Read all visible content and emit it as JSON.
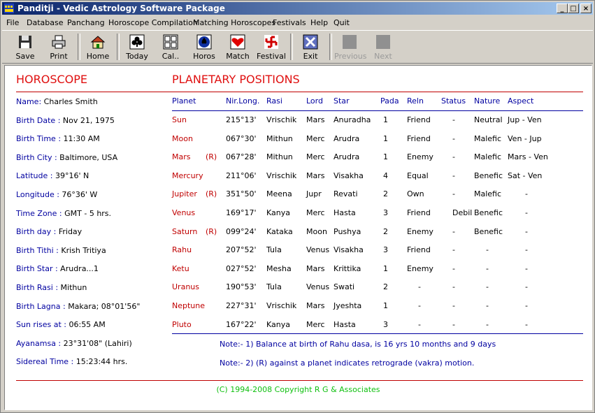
{
  "window": {
    "title": "Panditji - Vedic Astrology Software Package"
  },
  "menu": [
    "File",
    "Database",
    "Panchang",
    "Horoscope Compilation",
    "Matching Horoscopes",
    "Festivals",
    "Help",
    "Quit"
  ],
  "toolbar": {
    "save": "Save",
    "print": "Print",
    "home": "Home",
    "today": "Today",
    "cal": "Cal..",
    "horos": "Horos",
    "match": "Match",
    "festival": "Festival",
    "exit": "Exit",
    "previous": "Previous",
    "next": "Next"
  },
  "horoscope": {
    "heading": "HOROSCOPE",
    "fields": [
      {
        "label": "Name:",
        "value": "Charles Smith"
      },
      {
        "label": "Birth Date :",
        "value": "Nov 21, 1975"
      },
      {
        "label": "Birth Time :",
        "value": "11:30 AM"
      },
      {
        "label": "Birth City :",
        "value": "Baltimore,  USA"
      },
      {
        "label": "Latitude :",
        "value": "39°16' N"
      },
      {
        "label": "Longitude :",
        "value": "76°36' W"
      },
      {
        "label": "Time Zone :",
        "value": "GMT - 5 hrs."
      },
      {
        "label": "Birth day :",
        "value": "Friday"
      },
      {
        "label": "Birth Tithi :",
        "value": "Krish  Tritiya"
      },
      {
        "label": "Birth Star :",
        "value": "Arudra...1"
      },
      {
        "label": "Birth Rasi :",
        "value": "Mithun"
      },
      {
        "label": "Birth Lagna :",
        "value": "Makara; 08°01'56\""
      },
      {
        "label": "Sun rises at :",
        "value": "06:55 AM"
      },
      {
        "label": "Ayanamsa :",
        "value": "23°31'08\" (Lahiri)"
      },
      {
        "label": "Sidereal Time :",
        "value": "15:23:44 hrs."
      }
    ]
  },
  "positions": {
    "heading": "PLANETARY POSITIONS",
    "columns": [
      "Planet",
      "Nir.Long.",
      "Rasi",
      "Lord",
      "Star",
      "Pada",
      "Reln",
      "Status",
      "Nature",
      "Aspect"
    ],
    "rows": [
      [
        "Sun",
        "",
        "215°13'",
        "Vrischik",
        "Mars",
        "Anuradha",
        "1",
        "Friend",
        "-",
        "Neutral",
        "Jup - Ven"
      ],
      [
        "Moon",
        "",
        "067°30'",
        "Mithun",
        "Merc",
        "Arudra",
        "1",
        "Friend",
        "-",
        "Malefic",
        "Ven - Jup"
      ],
      [
        "Mars",
        "(R)",
        "067°28'",
        "Mithun",
        "Merc",
        "Arudra",
        "1",
        "Enemy",
        "-",
        "Malefic",
        "Mars - Ven"
      ],
      [
        "Mercury",
        "",
        "211°06'",
        "Vrischik",
        "Mars",
        "Visakha",
        "4",
        "Equal",
        "-",
        "Benefic",
        "Sat - Ven"
      ],
      [
        "Jupiter",
        "(R)",
        "351°50'",
        "Meena",
        "Jupr",
        "Revati",
        "2",
        "Own",
        "-",
        "Malefic",
        "-"
      ],
      [
        "Venus",
        "",
        "169°17'",
        "Kanya",
        "Merc",
        "Hasta",
        "3",
        "Friend",
        "Debil",
        "Benefic",
        "-"
      ],
      [
        "Saturn",
        "(R)",
        "099°24'",
        "Kataka",
        "Moon",
        "Pushya",
        "2",
        "Enemy",
        "-",
        "Benefic",
        "-"
      ],
      [
        "Rahu",
        "",
        "207°52'",
        "Tula",
        "Venus",
        "Visakha",
        "3",
        "Friend",
        "-",
        "-",
        "-"
      ],
      [
        "Ketu",
        "",
        "027°52'",
        "Mesha",
        "Mars",
        "Krittika",
        "1",
        "Enemy",
        "-",
        "-",
        "-"
      ],
      [
        "Uranus",
        "",
        "190°53'",
        "Tula",
        "Venus",
        "Swati",
        "2",
        "-",
        "-",
        "-",
        "-"
      ],
      [
        "Neptune",
        "",
        "227°31'",
        "Vrischik",
        "Mars",
        "Jyeshta",
        "1",
        "-",
        "-",
        "-",
        "-"
      ],
      [
        "Pluto",
        "",
        "167°22'",
        "Kanya",
        "Merc",
        "Hasta",
        "3",
        "-",
        "-",
        "-",
        "-"
      ]
    ],
    "notes": [
      "Note:- 1)  Balance at birth of Rahu dasa, is 16 yrs 10 months and 9 days",
      "Note:- 2)  (R) against a planet indicates retrograde (vakra) motion."
    ]
  },
  "footer": {
    "copyright": "(C) 1994-2008 Copyright R G & Associates"
  }
}
